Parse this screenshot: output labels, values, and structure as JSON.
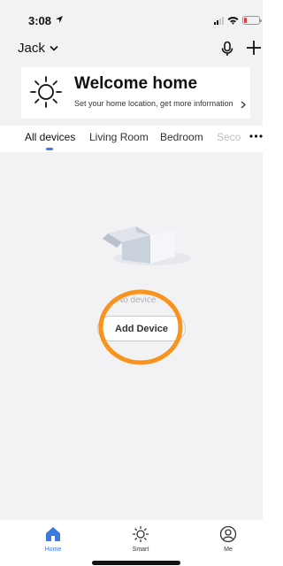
{
  "status_bar": {
    "time": "3:08",
    "icons": [
      "location-arrow-icon",
      "cellular-signal-icon",
      "wifi-icon",
      "battery-icon"
    ],
    "battery_color": "#e53935",
    "battery_level": 0.2
  },
  "header": {
    "home_name": "Jack",
    "home_menu_icon": "chevron-down-icon",
    "mic_icon": "microphone-icon",
    "add_icon": "plus-icon"
  },
  "welcome": {
    "icon": "sun-icon",
    "title": "Welcome home",
    "subtitle": "Set your home location, get more information",
    "chevron": ">"
  },
  "tabs": {
    "items": [
      {
        "label": "All devices",
        "active": true
      },
      {
        "label": "Living Room"
      },
      {
        "label": "Bedroom"
      },
      {
        "label": "Seco"
      }
    ],
    "more_icon": "more-horizontal-icon",
    "accent": "#3b7be0"
  },
  "empty_state": {
    "illustration": "empty-box-illustration",
    "text": "No device",
    "button_label": "Add Device",
    "highlight_color": "#f7931e"
  },
  "bottom_nav": {
    "items": [
      {
        "label": "Home",
        "icon": "home-icon",
        "active": true
      },
      {
        "label": "Smart",
        "icon": "sun-icon"
      },
      {
        "label": "Me",
        "icon": "profile-icon"
      }
    ],
    "active_color": "#3b7be0"
  }
}
